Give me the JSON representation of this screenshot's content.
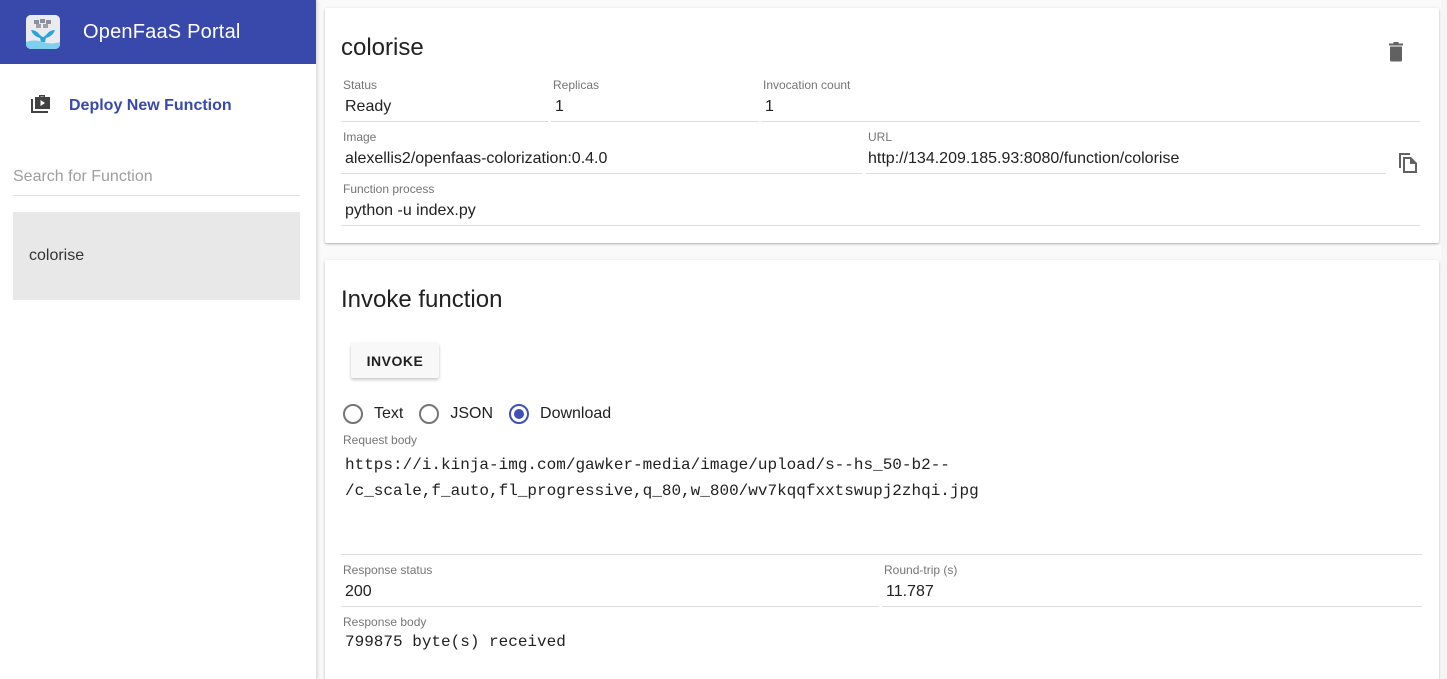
{
  "app": {
    "title": "OpenFaaS Portal",
    "brand_color": "#3949ab"
  },
  "sidebar": {
    "deploy_label": "Deploy New Function",
    "deploy_icon": "video-briefcase-icon",
    "search_placeholder": "Search for Function",
    "search_value": "",
    "functions": [
      {
        "name": "colorise",
        "selected": true
      }
    ]
  },
  "details": {
    "title": "colorise",
    "delete_icon": "trash-icon",
    "copy_icon": "copy-icon",
    "status": {
      "label": "Status",
      "value": "Ready"
    },
    "replicas": {
      "label": "Replicas",
      "value": "1"
    },
    "invocation_count": {
      "label": "Invocation count",
      "value": "1"
    },
    "image": {
      "label": "Image",
      "value": "alexellis2/openfaas-colorization:0.4.0"
    },
    "url": {
      "label": "URL",
      "value": "http://134.209.185.93:8080/function/colorise"
    },
    "function_process": {
      "label": "Function process",
      "value": "python -u index.py"
    }
  },
  "invoke": {
    "title": "Invoke function",
    "invoke_button": "INVOKE",
    "content_types": [
      {
        "label": "Text",
        "checked": false
      },
      {
        "label": "JSON",
        "checked": false
      },
      {
        "label": "Download",
        "checked": true
      }
    ],
    "request_body": {
      "label": "Request body",
      "line1": "https://i.kinja-img.com/gawker-media/image/upload/s--hs_50-b2--",
      "line2": "/c_scale,f_auto,fl_progressive,q_80,w_800/wv7kqqfxxtswupj2zhqi.jpg"
    },
    "response_status": {
      "label": "Response status",
      "value": "200"
    },
    "round_trip": {
      "label": "Round-trip (s)",
      "value": "11.787"
    },
    "response_body": {
      "label": "Response body",
      "value": "799875 byte(s) received"
    }
  }
}
